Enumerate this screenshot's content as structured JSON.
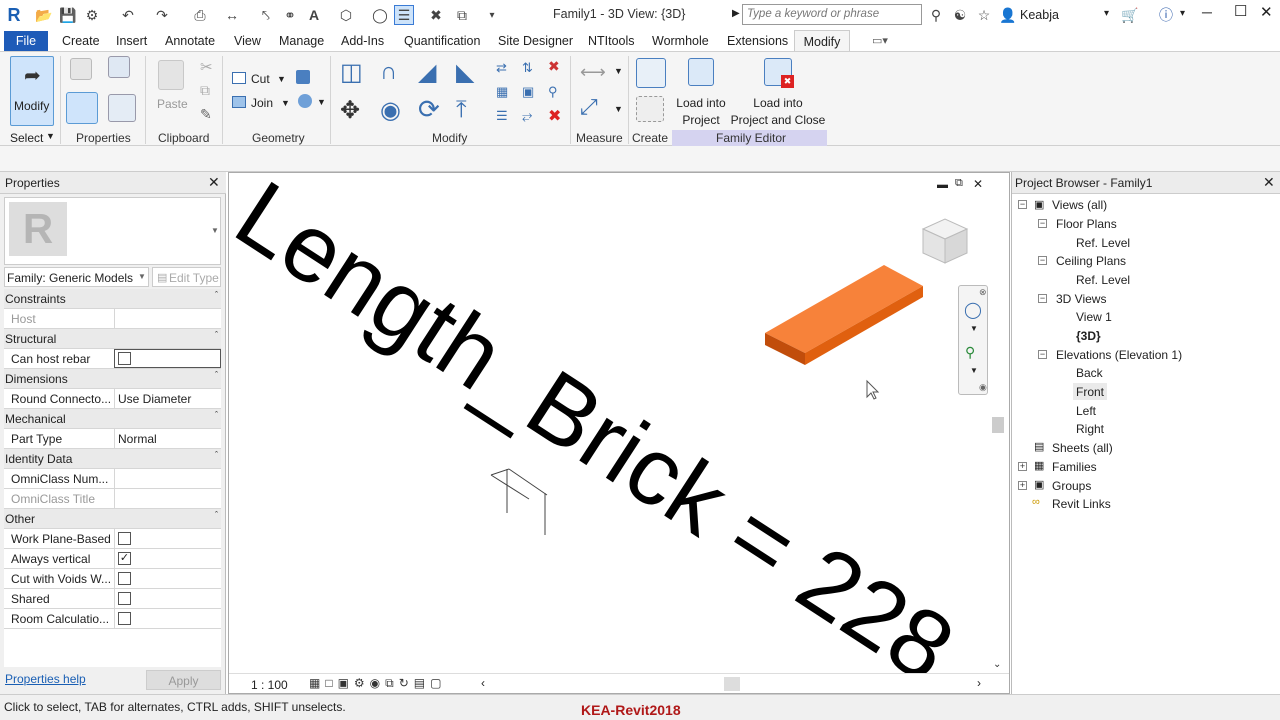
{
  "titlebar": {
    "title": "Family1 - 3D View: {3D}",
    "search_placeholder": "Type a keyword or phrase",
    "user": "Keabja"
  },
  "tabs": [
    "File",
    "Create",
    "Insert",
    "Annotate",
    "View",
    "Manage",
    "Add-Ins",
    "Quantification",
    "Site Designer",
    "NTItools",
    "Wormhole",
    "Extensions",
    "Modify"
  ],
  "ribbon": {
    "modify_label": "Modify",
    "paste_label": "Paste",
    "cut_label": "Cut",
    "join_label": "Join",
    "load_into_project_line1": "Load into",
    "load_into_project_line2": "Project",
    "load_close_line1": "Load into",
    "load_close_line2": "Project and Close",
    "panels": {
      "select": "Select",
      "properties": "Properties",
      "clipboard": "Clipboard",
      "geometry": "Geometry",
      "modify": "Modify",
      "measure": "Measure",
      "create": "Create",
      "family_editor": "Family Editor"
    }
  },
  "properties": {
    "title": "Properties",
    "family_selector": "Family: Generic Models",
    "edit_type": "Edit Type",
    "sections": {
      "constraints": "Constraints",
      "structural": "Structural",
      "dimensions": "Dimensions",
      "mechanical": "Mechanical",
      "identity": "Identity Data",
      "other": "Other"
    },
    "rows": {
      "host": "Host",
      "can_host_rebar": "Can host rebar",
      "round_connector": "Round Connecto...",
      "round_connector_val": "Use Diameter",
      "part_type": "Part Type",
      "part_type_val": "Normal",
      "omniclass_num": "OmniClass Num...",
      "omniclass_title": "OmniClass Title",
      "work_plane": "Work Plane-Based",
      "always_vertical": "Always vertical",
      "cut_voids": "Cut with Voids W...",
      "shared": "Shared",
      "room_calc": "Room Calculatio..."
    },
    "help_link": "Properties help",
    "apply": "Apply"
  },
  "view": {
    "dimension_text": "Length_Brick = 228",
    "scale": "1 : 100",
    "brick_color": "#f26a1b"
  },
  "browser": {
    "title": "Project Browser - Family1",
    "items": {
      "views_all": "Views (all)",
      "floor_plans": "Floor Plans",
      "fp_ref": "Ref. Level",
      "ceiling_plans": "Ceiling Plans",
      "cp_ref": "Ref. Level",
      "views_3d": "3D Views",
      "view1": "View 1",
      "view_3d": "{3D}",
      "elevations": "Elevations (Elevation 1)",
      "back": "Back",
      "front": "Front",
      "left": "Left",
      "right": "Right",
      "sheets": "Sheets (all)",
      "families": "Families",
      "groups": "Groups",
      "revit_links": "Revit Links"
    }
  },
  "status": {
    "hint": "Click to select, TAB for alternates, CTRL adds, SHIFT unselects.",
    "watermark": "KEA-Revit2018"
  }
}
